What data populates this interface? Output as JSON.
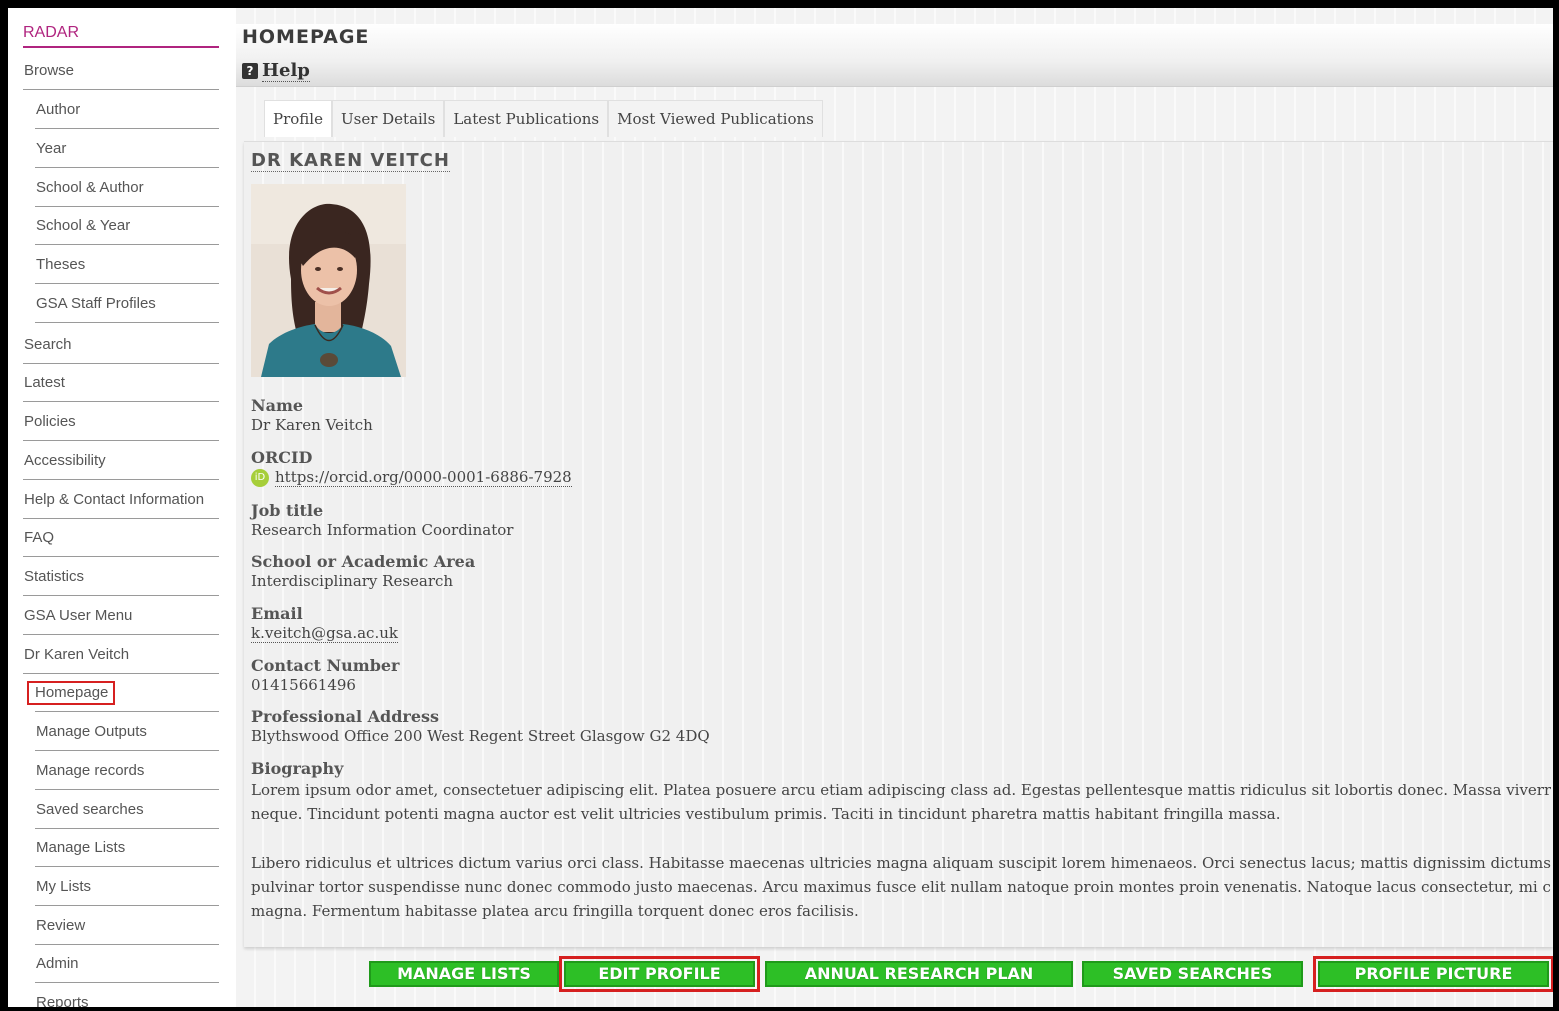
{
  "sidebar": {
    "brand": "RADAR",
    "items": [
      {
        "label": "Browse"
      },
      {
        "label": "Author"
      },
      {
        "label": "Year"
      },
      {
        "label": "School & Author"
      },
      {
        "label": "School & Year"
      },
      {
        "label": "Theses"
      },
      {
        "label": "GSA Staff Profiles"
      },
      {
        "label": "Search"
      },
      {
        "label": "Latest"
      },
      {
        "label": "Policies"
      },
      {
        "label": "Accessibility"
      },
      {
        "label": "Help & Contact Information"
      },
      {
        "label": "FAQ"
      },
      {
        "label": "Statistics"
      },
      {
        "label": "GSA User Menu"
      },
      {
        "label": "Dr Karen Veitch"
      },
      {
        "label": "Homepage"
      },
      {
        "label": "Manage Outputs"
      },
      {
        "label": "Manage records"
      },
      {
        "label": "Saved searches"
      },
      {
        "label": "Manage Lists"
      },
      {
        "label": "My Lists"
      },
      {
        "label": "Review"
      },
      {
        "label": "Admin"
      },
      {
        "label": "Reports"
      }
    ]
  },
  "header": {
    "title": "HOMEPAGE",
    "help_label": "Help",
    "help_icon": "question-icon"
  },
  "tabs": [
    {
      "label": "Profile",
      "active": true
    },
    {
      "label": "User Details"
    },
    {
      "label": "Latest Publications"
    },
    {
      "label": "Most Viewed Publications"
    }
  ],
  "profile": {
    "heading": "DR KAREN VEITCH",
    "fields": {
      "name_label": "Name",
      "name": "Dr Karen Veitch",
      "orcid_label": "ORCID",
      "orcid_url": "https://orcid.org/0000-0001-6886-7928",
      "orcid_icon_text": "iD",
      "job_label": "Job title",
      "job": "Research Information Coordinator",
      "school_label": "School or Academic Area",
      "school": "Interdisciplinary Research",
      "email_label": "Email",
      "email": "k.veitch@gsa.ac.uk",
      "contact_label": "Contact Number",
      "contact": "01415661496",
      "address_label": "Professional Address",
      "address": "Blythswood Office 200 West Regent Street Glasgow G2 4DQ",
      "bio_label": "Biography",
      "bio_lines": [
        "Lorem ipsum odor amet, consectetuer adipiscing elit. Platea posuere arcu etiam adipiscing class ad. Egestas pellentesque mattis ridiculus sit lobortis donec. Massa viverra sociosqu eleifend eff",
        "neque. Tincidunt potenti magna auctor est velit ultricies vestibulum primis. Taciti in tincidunt pharetra mattis habitant fringilla massa.",
        "Libero ridiculus et ultrices dictum varius orci class. Habitasse maecenas ultricies magna aliquam suscipit lorem himenaeos. Orci senectus lacus; mattis dignissim dictumst ut. Urna non nascet",
        "pulvinar tortor suspendisse nunc donec commodo justo maecenas. Arcu maximus fusce elit nullam natoque proin montes proin venenatis. Natoque lacus consectetur, mi conubia pulvinar mat",
        "magna. Fermentum habitasse platea arcu fringilla torquent donec eros facilisis."
      ]
    }
  },
  "actions": [
    {
      "label": "MANAGE LISTS"
    },
    {
      "label": "EDIT PROFILE"
    },
    {
      "label": "ANNUAL RESEARCH PLAN"
    },
    {
      "label": "SAVED SEARCHES"
    },
    {
      "label": "PROFILE PICTURE"
    }
  ],
  "colors": {
    "brand": "#b0247f",
    "action_green": "#2dbf26",
    "highlight_red": "#d62020",
    "orcid_green": "#a6ce39"
  }
}
